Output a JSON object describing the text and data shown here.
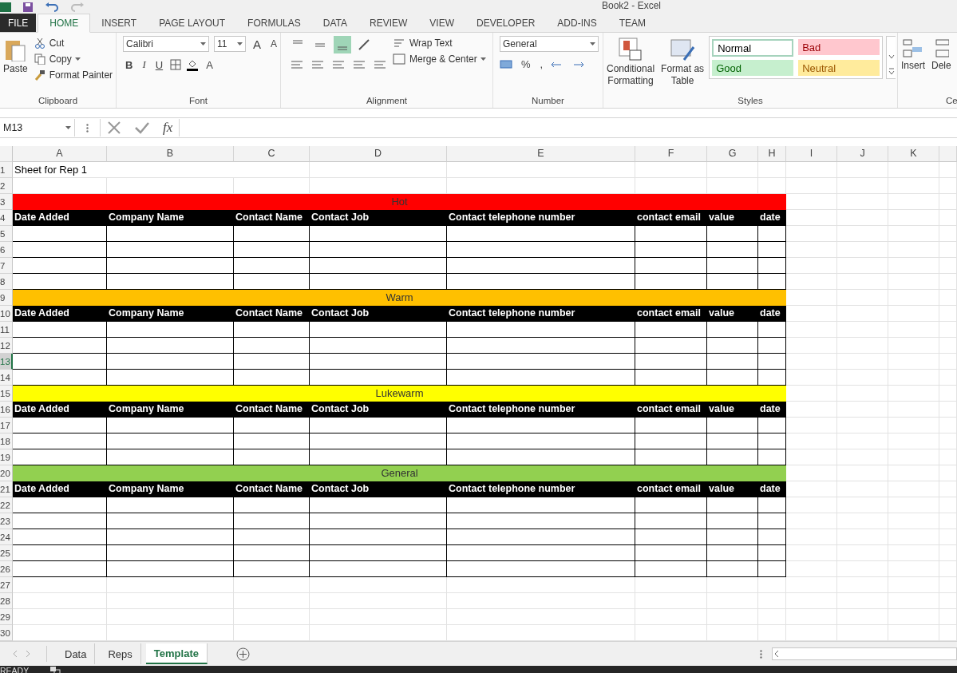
{
  "window": {
    "title": "Book2 - Excel"
  },
  "tabs": [
    {
      "label": "FILE",
      "kind": "file",
      "selected": false
    },
    {
      "label": "HOME",
      "kind": "tab",
      "selected": true
    },
    {
      "label": "INSERT",
      "kind": "tab",
      "selected": false
    },
    {
      "label": "PAGE LAYOUT",
      "kind": "tab",
      "selected": false
    },
    {
      "label": "FORMULAS",
      "kind": "tab",
      "selected": false
    },
    {
      "label": "DATA",
      "kind": "tab",
      "selected": false
    },
    {
      "label": "REVIEW",
      "kind": "tab",
      "selected": false
    },
    {
      "label": "VIEW",
      "kind": "tab",
      "selected": false
    },
    {
      "label": "DEVELOPER",
      "kind": "tab",
      "selected": false
    },
    {
      "label": "ADD-INS",
      "kind": "tab",
      "selected": false
    },
    {
      "label": "TEAM",
      "kind": "tab",
      "selected": false
    }
  ],
  "clipboard": {
    "paste": "Paste",
    "cut": "Cut",
    "copy": "Copy",
    "painter": "Format Painter",
    "label": "Clipboard"
  },
  "font": {
    "family": "Calibri",
    "size": "11",
    "grow": "A",
    "shrink": "A",
    "style_buttons": [
      "B",
      "I",
      "U"
    ],
    "font_color": "A",
    "label": "Font"
  },
  "alignment": {
    "vertical": [
      {
        "selected": false
      },
      {
        "selected": false
      },
      {
        "selected": true
      }
    ],
    "wrap": "Wrap Text",
    "merge": "Merge & Center",
    "label": "Alignment"
  },
  "number": {
    "format": "General",
    "symbols": [
      "%",
      ","
    ],
    "label": "Number"
  },
  "styles": {
    "conditional": "Conditional Formatting",
    "format_table": "Format as Table",
    "label": "Styles",
    "gallery": [
      {
        "label": "Normal",
        "kind": "normal"
      },
      {
        "label": "Bad",
        "kind": "bad"
      },
      {
        "label": "Good",
        "kind": "good"
      },
      {
        "label": "Neutral",
        "kind": "neutral"
      }
    ]
  },
  "cells": {
    "insert": "Insert",
    "delete": "Dele",
    "label": "Ce"
  },
  "formula_bar": {
    "name_box": "M13",
    "fx": "fx"
  },
  "columns": [
    "A",
    "B",
    "C",
    "D",
    "E",
    "F",
    "G",
    "H",
    "I",
    "J",
    "K"
  ],
  "rows": [
    {
      "n": "1",
      "kind": "title",
      "selected": false,
      "cells": [
        "Sheet for Rep 1"
      ]
    },
    {
      "n": "2",
      "kind": "blank",
      "selected": false
    },
    {
      "n": "3",
      "kind": "band",
      "selected": false,
      "text": "Hot",
      "color": "#ff0000"
    },
    {
      "n": "4",
      "kind": "header",
      "selected": false,
      "cells": [
        "Date Added",
        "Company Name",
        "Contact Name",
        "Contact Job",
        "Contact telephone number",
        "contact email",
        "value",
        "date"
      ]
    },
    {
      "n": "5",
      "kind": "data",
      "selected": false
    },
    {
      "n": "6",
      "kind": "data",
      "selected": false
    },
    {
      "n": "7",
      "kind": "data",
      "selected": false
    },
    {
      "n": "8",
      "kind": "data",
      "selected": false
    },
    {
      "n": "9",
      "kind": "band",
      "selected": false,
      "text": "Warm",
      "color": "#ffc000"
    },
    {
      "n": "10",
      "kind": "header",
      "selected": false,
      "cells": [
        "Date Added",
        "Company Name",
        "Contact Name",
        "Contact Job",
        "Contact telephone number",
        "contact email",
        "value",
        "date"
      ]
    },
    {
      "n": "11",
      "kind": "data",
      "selected": false
    },
    {
      "n": "12",
      "kind": "data",
      "selected": false
    },
    {
      "n": "13",
      "kind": "data",
      "selected": true
    },
    {
      "n": "14",
      "kind": "data",
      "selected": false
    },
    {
      "n": "15",
      "kind": "band",
      "selected": false,
      "text": "Lukewarm",
      "color": "#ffff00"
    },
    {
      "n": "16",
      "kind": "header",
      "selected": false,
      "cells": [
        "Date Added",
        "Company Name",
        "Contact Name",
        "Contact Job",
        "Contact telephone number",
        "contact email",
        "value",
        "date"
      ]
    },
    {
      "n": "17",
      "kind": "data",
      "selected": false
    },
    {
      "n": "18",
      "kind": "data",
      "selected": false
    },
    {
      "n": "19",
      "kind": "data",
      "selected": false
    },
    {
      "n": "20",
      "kind": "band",
      "selected": false,
      "text": "General",
      "color": "#92d050"
    },
    {
      "n": "21",
      "kind": "header",
      "selected": false,
      "cells": [
        "Date Added",
        "Company Name",
        "Contact Name",
        "Contact Job",
        "Contact telephone number",
        "contact email",
        "value",
        "date"
      ]
    },
    {
      "n": "22",
      "kind": "data",
      "selected": false
    },
    {
      "n": "23",
      "kind": "data",
      "selected": false
    },
    {
      "n": "24",
      "kind": "data",
      "selected": false
    },
    {
      "n": "25",
      "kind": "data",
      "selected": false
    },
    {
      "n": "26",
      "kind": "data",
      "selected": false
    },
    {
      "n": "27",
      "kind": "blank",
      "selected": false
    },
    {
      "n": "28",
      "kind": "blank",
      "selected": false
    },
    {
      "n": "29",
      "kind": "blank",
      "selected": false
    },
    {
      "n": "30",
      "kind": "blank",
      "selected": false
    }
  ],
  "sheet_tabs": [
    {
      "label": "Data",
      "selected": false
    },
    {
      "label": "Reps",
      "selected": false
    },
    {
      "label": "Template",
      "selected": true
    }
  ],
  "status_bar": {
    "text": "READY"
  }
}
